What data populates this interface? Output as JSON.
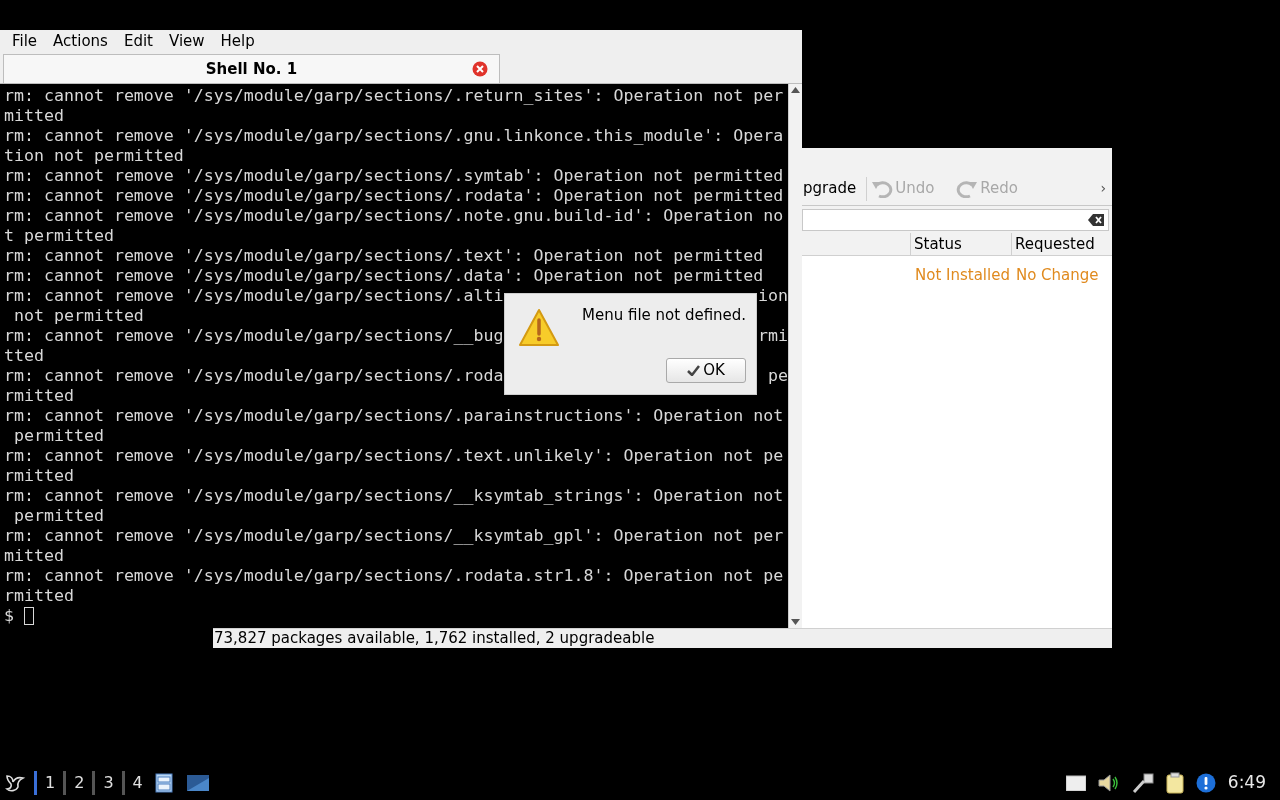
{
  "terminal_window": {
    "menu": [
      "File",
      "Actions",
      "Edit",
      "View",
      "Help"
    ],
    "tabs": [
      {
        "label": "Shell No. 1",
        "selected": true
      }
    ],
    "lines": [
      {
        "text": "rm: cannot remove '/sys/module/garp/sections/.return_sites': Operation not per"
      },
      {
        "text": "mitted"
      },
      {
        "text": "rm: cannot remove '/sys/module/garp/sections/.gnu.linkonce.this_module': Opera"
      },
      {
        "text": "tion not permitted"
      },
      {
        "text": "rm: cannot remove '/sys/module/garp/sections/.symtab': Operation not permitted"
      },
      {
        "text": "rm: cannot remove '/sys/module/garp/sections/.rodata': Operation not permitted"
      },
      {
        "text": "rm: cannot remove '/sys/module/garp/sections/.note.gnu.build-id': Operation no"
      },
      {
        "text": "t permitted"
      },
      {
        "text": "rm: cannot remove '/sys/module/garp/sections/.text': Operation not permitted"
      },
      {
        "text": "rm: cannot remove '/sys/module/garp/sections/.data': Operation not permitted"
      },
      {
        "text": "rm: cannot remove '/sys/module/garp/sections/.alti",
        "text_right": "ion"
      },
      {
        "text": " not permitted"
      },
      {
        "text": "rm: cannot remove '/sys/module/garp/sections/__bug",
        "text_right": "rmi"
      },
      {
        "text": "tted"
      },
      {
        "text": "rm: cannot remove '/sys/module/garp/sections/.roda",
        "text_right": "pe"
      },
      {
        "text": "rmitted"
      },
      {
        "text": "rm: cannot remove '/sys/module/garp/sections/.parainstructions': Operation not"
      },
      {
        "text": " permitted"
      },
      {
        "text": "rm: cannot remove '/sys/module/garp/sections/.text.unlikely': Operation not pe"
      },
      {
        "text": "rmitted"
      },
      {
        "text": "rm: cannot remove '/sys/module/garp/sections/__ksymtab_strings': Operation not"
      },
      {
        "text": " permitted"
      },
      {
        "text": "rm: cannot remove '/sys/module/garp/sections/__ksymtab_gpl': Operation not per"
      },
      {
        "text": "mitted"
      },
      {
        "text": "rm: cannot remove '/sys/module/garp/sections/.rodata.str1.8': Operation not pe"
      },
      {
        "text": "rmitted"
      }
    ],
    "prompt": "$"
  },
  "dialog": {
    "message": "Menu file not defined.",
    "button": "OK"
  },
  "package_window": {
    "toolbar": [
      {
        "kind": "text",
        "label": "pgrade",
        "disabled": false
      },
      {
        "kind": "undo",
        "label": "Undo",
        "disabled": true
      },
      {
        "kind": "redo",
        "label": "Redo",
        "disabled": true
      }
    ],
    "overflow": "›",
    "columns": [
      "Status",
      "Requested"
    ],
    "rows": [
      {
        "status": "Not Installed",
        "requested": "No Change",
        "color": "#e08a1e"
      }
    ],
    "status_bar": "73,827 packages available, 1,762 installed, 2 upgradeable"
  },
  "taskbar": {
    "desktops": [
      {
        "label": "1",
        "selected": true
      },
      {
        "label": "2",
        "selected": false
      },
      {
        "label": "3",
        "selected": false
      },
      {
        "label": "4",
        "selected": false
      }
    ],
    "clock": "6:49"
  }
}
